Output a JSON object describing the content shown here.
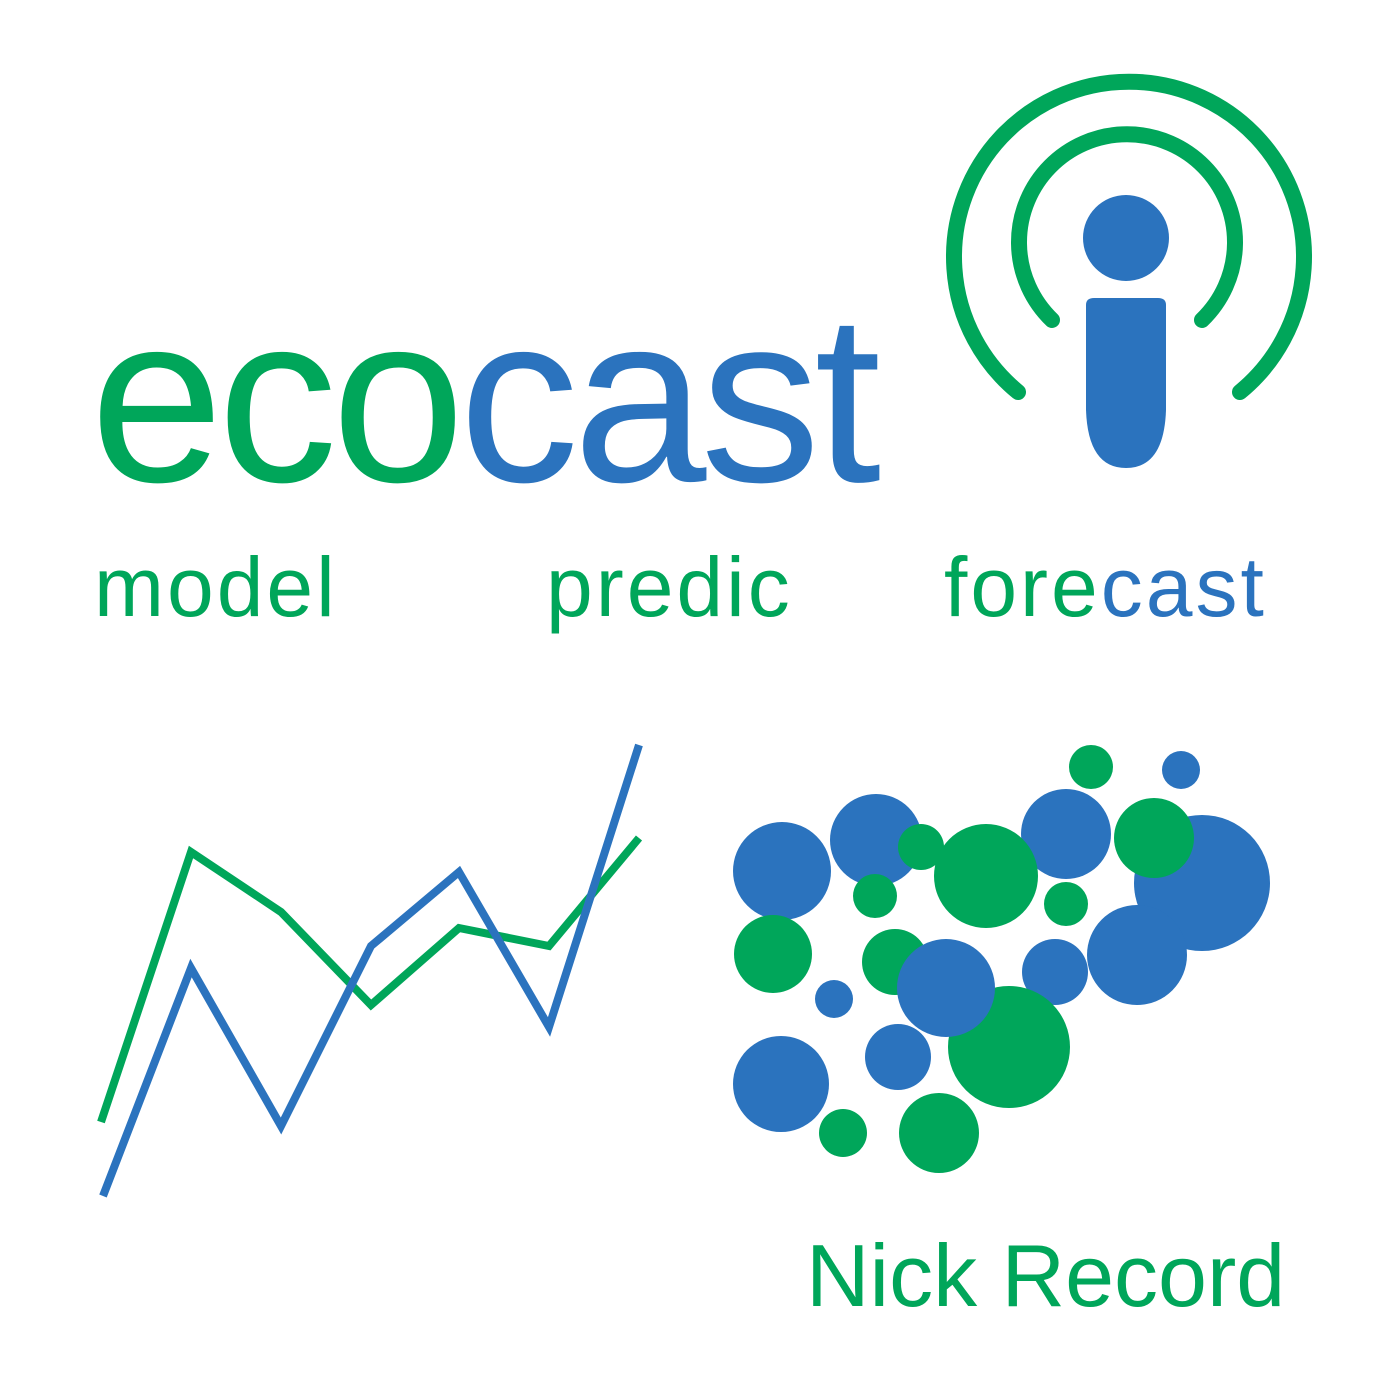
{
  "title": {
    "part1": "eco",
    "part2": "cast"
  },
  "tagline": {
    "word1": "model",
    "word2": "predic",
    "word3_part1": "fore",
    "word3_part2": "cast"
  },
  "author": "Nick Record",
  "icons": {
    "logo": "podcast-icon",
    "graphic_left": "line-graph-icon",
    "graphic_right": "bubble-cluster-icon"
  },
  "colors": {
    "green": "#00A65A",
    "blue": "#2B73BE",
    "background": "#FFFFFF"
  }
}
